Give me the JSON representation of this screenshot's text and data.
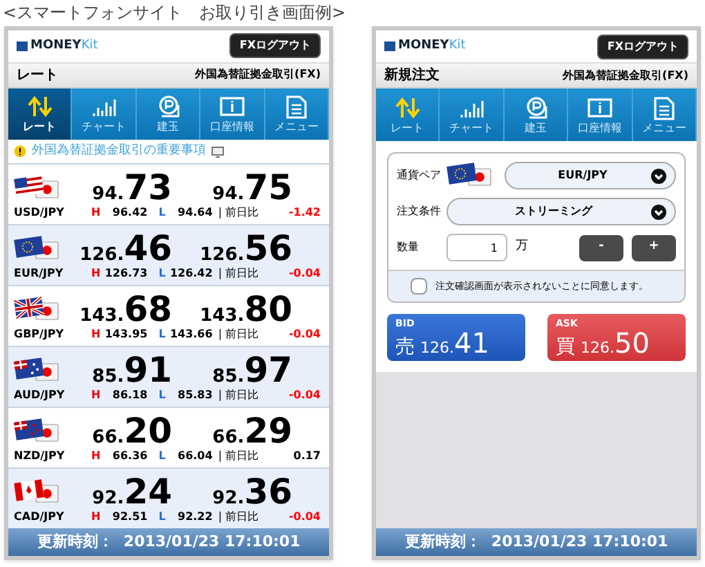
{
  "caption": "<スマートフォンサイト　お取り引き画面例>",
  "phones": [
    {
      "brand": {
        "money": "MONEY",
        "kit": "Kit"
      },
      "logout": "FXログアウト",
      "page_title": "レート",
      "section": "外国為替証拠金取引(FX)",
      "tabs": [
        {
          "kind": "rate",
          "label": "レート",
          "selected": true
        },
        {
          "kind": "chart",
          "label": "チャート",
          "selected": false
        },
        {
          "kind": "position",
          "label": "建玉",
          "selected": false
        },
        {
          "kind": "account",
          "label": "口座情報",
          "selected": false
        },
        {
          "kind": "menu",
          "label": "メニュー",
          "selected": false
        }
      ],
      "notice": "外国為替証拠金取引の重要事項",
      "rates": [
        {
          "kind": "usd",
          "pair": "USD/JPY",
          "bid": {
            "head": "94.",
            "tail": "73"
          },
          "ask": {
            "head": "94.",
            "tail": "75"
          },
          "h_label": "H",
          "high": "96.42",
          "l_label": "L",
          "low": "94.64",
          "change_label": "| 前日比",
          "change": "-1.42",
          "color": "#ff0000"
        },
        {
          "kind": "eur",
          "pair": "EUR/JPY",
          "bid": {
            "head": "126.",
            "tail": "46"
          },
          "ask": {
            "head": "126.",
            "tail": "56"
          },
          "h_label": "H",
          "high": "126.73",
          "l_label": "L",
          "low": "126.42",
          "change_label": "| 前日比",
          "change": "-0.04",
          "color": "#ff0000"
        },
        {
          "kind": "gbp",
          "pair": "GBP/JPY",
          "bid": {
            "head": "143.",
            "tail": "68"
          },
          "ask": {
            "head": "143.",
            "tail": "80"
          },
          "h_label": "H",
          "high": "143.95",
          "l_label": "L",
          "low": "143.66",
          "change_label": "| 前日比",
          "change": "-0.04",
          "color": "#ff0000"
        },
        {
          "kind": "aud",
          "pair": "AUD/JPY",
          "bid": {
            "head": "85.",
            "tail": "91"
          },
          "ask": {
            "head": "85.",
            "tail": "97"
          },
          "h_label": "H",
          "high": "86.18",
          "l_label": "L",
          "low": "85.83",
          "change_label": "| 前日比",
          "change": "-0.04",
          "color": "#ff0000"
        },
        {
          "kind": "nzd",
          "pair": "NZD/JPY",
          "bid": {
            "head": "66.",
            "tail": "20"
          },
          "ask": {
            "head": "66.",
            "tail": "29"
          },
          "h_label": "H",
          "high": "66.36",
          "l_label": "L",
          "low": "66.04",
          "change_label": "| 前日比",
          "change": "0.17",
          "color": "#000000"
        },
        {
          "kind": "cad",
          "pair": "CAD/JPY",
          "bid": {
            "head": "92.",
            "tail": "24"
          },
          "ask": {
            "head": "92.",
            "tail": "36"
          },
          "h_label": "H",
          "high": "92.51",
          "l_label": "L",
          "low": "92.22",
          "change_label": "| 前日比",
          "change": "-0.04",
          "color": "#ff0000"
        }
      ],
      "footer": "更新時刻：  2013/01/23 17:10:01"
    },
    {
      "brand": {
        "money": "MONEY",
        "kit": "Kit"
      },
      "logout": "FXログアウト",
      "page_title": "新規注文",
      "section": "外国為替証拠金取引(FX)",
      "tabs": [
        {
          "kind": "rate",
          "label": "レート",
          "selected": false
        },
        {
          "kind": "chart",
          "label": "チャート",
          "selected": false
        },
        {
          "kind": "position",
          "label": "建玉",
          "selected": false
        },
        {
          "kind": "account",
          "label": "口座情報",
          "selected": false
        },
        {
          "kind": "menu",
          "label": "メニュー",
          "selected": false
        }
      ],
      "order": {
        "pair_label": "通貨ペア",
        "flag": {
          "kind": "eur"
        },
        "pair": "EUR/JPY",
        "condition_label": "注文条件",
        "condition": "ストリーミング",
        "qty_label": "数量",
        "qty": "1",
        "unit": "万",
        "minus": "-",
        "plus": "+",
        "confirm": {
          "label": "注文確認画面が表示されないことに同意します。",
          "checked": false
        },
        "bid": {
          "tag": "BID",
          "side": "売",
          "head": "126.",
          "tail": "41"
        },
        "ask": {
          "tag": "ASK",
          "side": "買",
          "head": "126.",
          "tail": "50"
        }
      },
      "footer": "更新時刻：  2013/01/23 17:10:01"
    }
  ]
}
